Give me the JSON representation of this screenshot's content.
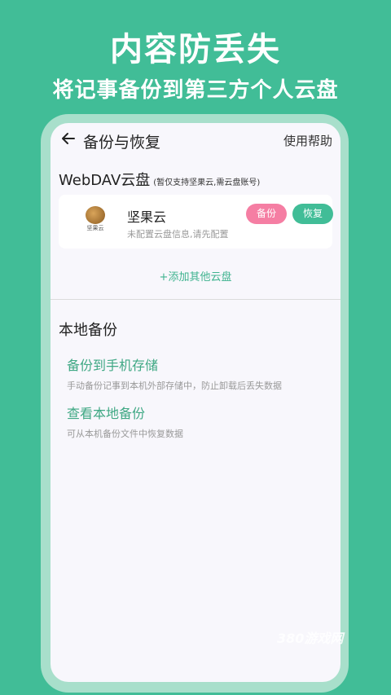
{
  "promo": {
    "title": "内容防丢失",
    "subtitle": "将记事备份到第三方个人云盘"
  },
  "header": {
    "title": "备份与恢复",
    "help": "使用帮助",
    "back_icon": "arrow-left-icon"
  },
  "webdav": {
    "title": "WebDAV云盘",
    "note": "(暂仅支持坚果云,需云盘账号)",
    "card": {
      "logo_text": "坚果云",
      "name": "坚果云",
      "status": "未配置云盘信息,请先配置",
      "backup_label": "备份",
      "restore_label": "恢复"
    },
    "add_label": "+添加其他云盘"
  },
  "local": {
    "title": "本地备份",
    "items": [
      {
        "title": "备份到手机存储",
        "desc": "手动备份记事到本机外部存储中，防止卸载后丢失数据"
      },
      {
        "title": "查看本地备份",
        "desc": "可从本机备份文件中恢复数据"
      }
    ]
  },
  "colors": {
    "brand_green": "#41bd97",
    "backup_pink": "#f57ea3"
  },
  "watermark": "380游戏网"
}
